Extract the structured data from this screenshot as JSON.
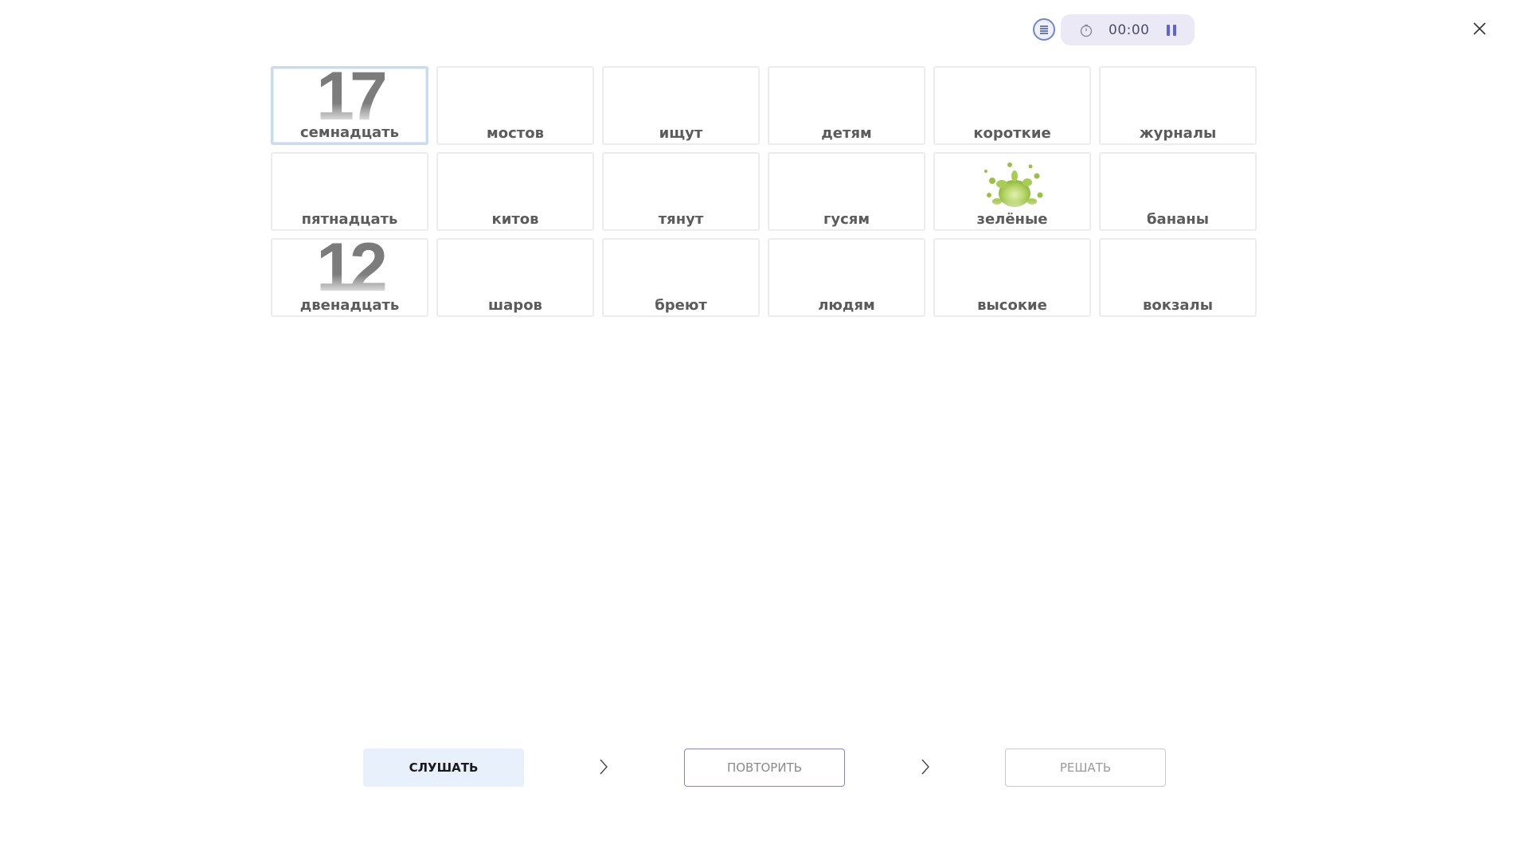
{
  "header": {
    "list_icon": "list-icon",
    "timer": {
      "clock_icon": "clock-icon",
      "time": "00:00",
      "pause_icon": "pause-icon"
    },
    "close_icon": "close-icon"
  },
  "colors": {
    "accent": "#6f86d6",
    "timer_bg": "#ece9f7",
    "listen_bg": "#e8f0fc",
    "repeat_border": "#8a7fd8",
    "card_border": "#ececec",
    "selected_border": "#c9dbee",
    "word_text": "#5b5b5b"
  },
  "cards": [
    {
      "word": "семнадцать",
      "numeral": "17",
      "selected": true
    },
    {
      "word": "мостов"
    },
    {
      "word": "ищут"
    },
    {
      "word": "детям"
    },
    {
      "word": "короткие"
    },
    {
      "word": "журналы"
    },
    {
      "word": "пятнадцать"
    },
    {
      "word": "китов"
    },
    {
      "word": "тянут"
    },
    {
      "word": "гусям"
    },
    {
      "word": "зелёные",
      "icon": "green-splash-icon"
    },
    {
      "word": "бананы"
    },
    {
      "word": "двенадцать",
      "numeral": "12"
    },
    {
      "word": "шаров"
    },
    {
      "word": "бреют"
    },
    {
      "word": "людям"
    },
    {
      "word": "высокие"
    },
    {
      "word": "вокзалы"
    }
  ],
  "footer": {
    "listen_label": "СЛУШАТЬ",
    "repeat_label": "ПОВТОРИТЬ",
    "solve_label": "РЕШАТЬ",
    "arrow_icon": "chevron-right-icon"
  }
}
